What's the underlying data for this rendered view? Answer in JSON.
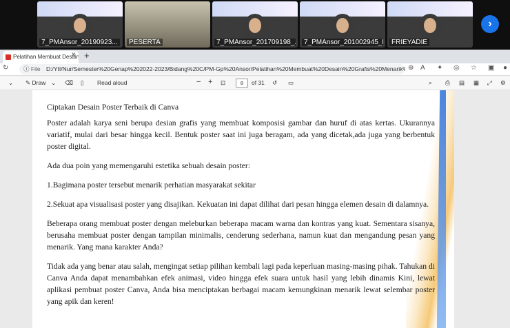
{
  "meeting": {
    "participants": [
      {
        "name": "7_PMAnsor_20190923..."
      },
      {
        "name": "PESERTA"
      },
      {
        "name": "7_PMAnsor_201709198_..."
      },
      {
        "name": "7_PMAnsor_201002945_F..."
      },
      {
        "name": "FRIEYADIE"
      }
    ],
    "next_icon": "chevron-right-icon"
  },
  "browser": {
    "tab_title": "Pelatihan Membuat Desain Grafis",
    "scheme_label": "File",
    "url": "D:/YII/Nur/Semester%20Genap%202022-2023/Bidang%20C/PM-Gp%20Ansor/Pelatihan%20Membuat%20Desain%20Grafis%20Menarik%20Menggunakan%2..."
  },
  "pdf_toolbar": {
    "draw_label": "Draw",
    "read_aloud_label": "Read aloud",
    "page_current": "8",
    "page_total": "of 31"
  },
  "document": {
    "title": "Ciptakan Desain Poster Terbaik di Canva",
    "paragraphs": [
      "Poster adalah karya seni berupa desian grafis yang membuat komposisi gambar dan huruf di atas kertas. Ukurannya variatif, mulai dari besar hingga kecil. Bentuk poster saat ini juga beragam, ada yang dicetak,ada juga yang berbentuk poster digital.",
      "Ada dua poin yang memengaruhi estetika sebuah desain poster:",
      "1.Bagimana poster tersebut menarik perhatian masyarakat sekitar",
      "2.Sekuat apa visualisasi poster yang disajikan. Kekuatan ini dapat dilihat dari pesan hingga elemen desain di dalamnya.",
      "Beberapa orang membuat poster dengan meleburkan beberapa macam warna dan kontras yang kuat. Sementara sisanya, berusaha membuat poster dengan tampilan minimalis, cenderung sederhana, namun kuat dan mengandung pesan yang menarik. Yang mana karakter Anda?",
      "Tidak ada yang benar atau salah, mengingat setiap pilihan kembali lagi pada keperluan masing-masing pihak. Tahukan di Canva Anda dapat menambahkan efek animasi, video hingga efek suara untuk hasil yang lebih dinamis Kini, lewat aplikasi pembuat poster Canva, Anda bisa menciptakan berbagai macam kemungkinan menarik lewat selembar poster yang apik dan keren!"
    ]
  },
  "colors": {
    "accent": "#1a73e8",
    "pdf_icon": "#d93025"
  }
}
